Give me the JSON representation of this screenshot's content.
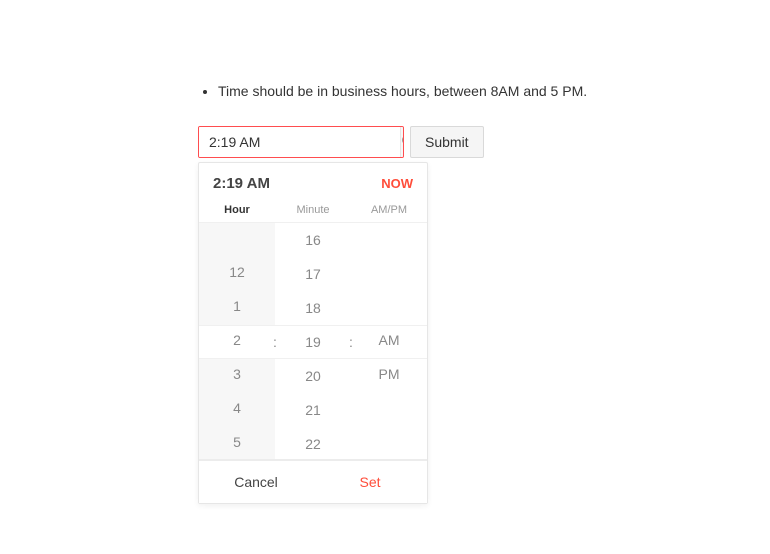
{
  "note": "Time should be in business hours, between 8AM and 5 PM.",
  "input": {
    "value": "2:19 AM"
  },
  "submit_label": "Submit",
  "picker": {
    "display_time": "2:19 AM",
    "now_label": "NOW",
    "labels": {
      "hour": "Hour",
      "minute": "Minute",
      "ampm": "AM/PM"
    },
    "sep": ":",
    "hour_values": [
      "",
      "12",
      "1",
      "2",
      "3",
      "4",
      "5"
    ],
    "minute_values": [
      "16",
      "17",
      "18",
      "19",
      "20",
      "21",
      "22"
    ],
    "ampm_values": [
      "",
      "",
      "",
      "AM",
      "PM",
      "",
      ""
    ],
    "cancel_label": "Cancel",
    "set_label": "Set"
  }
}
